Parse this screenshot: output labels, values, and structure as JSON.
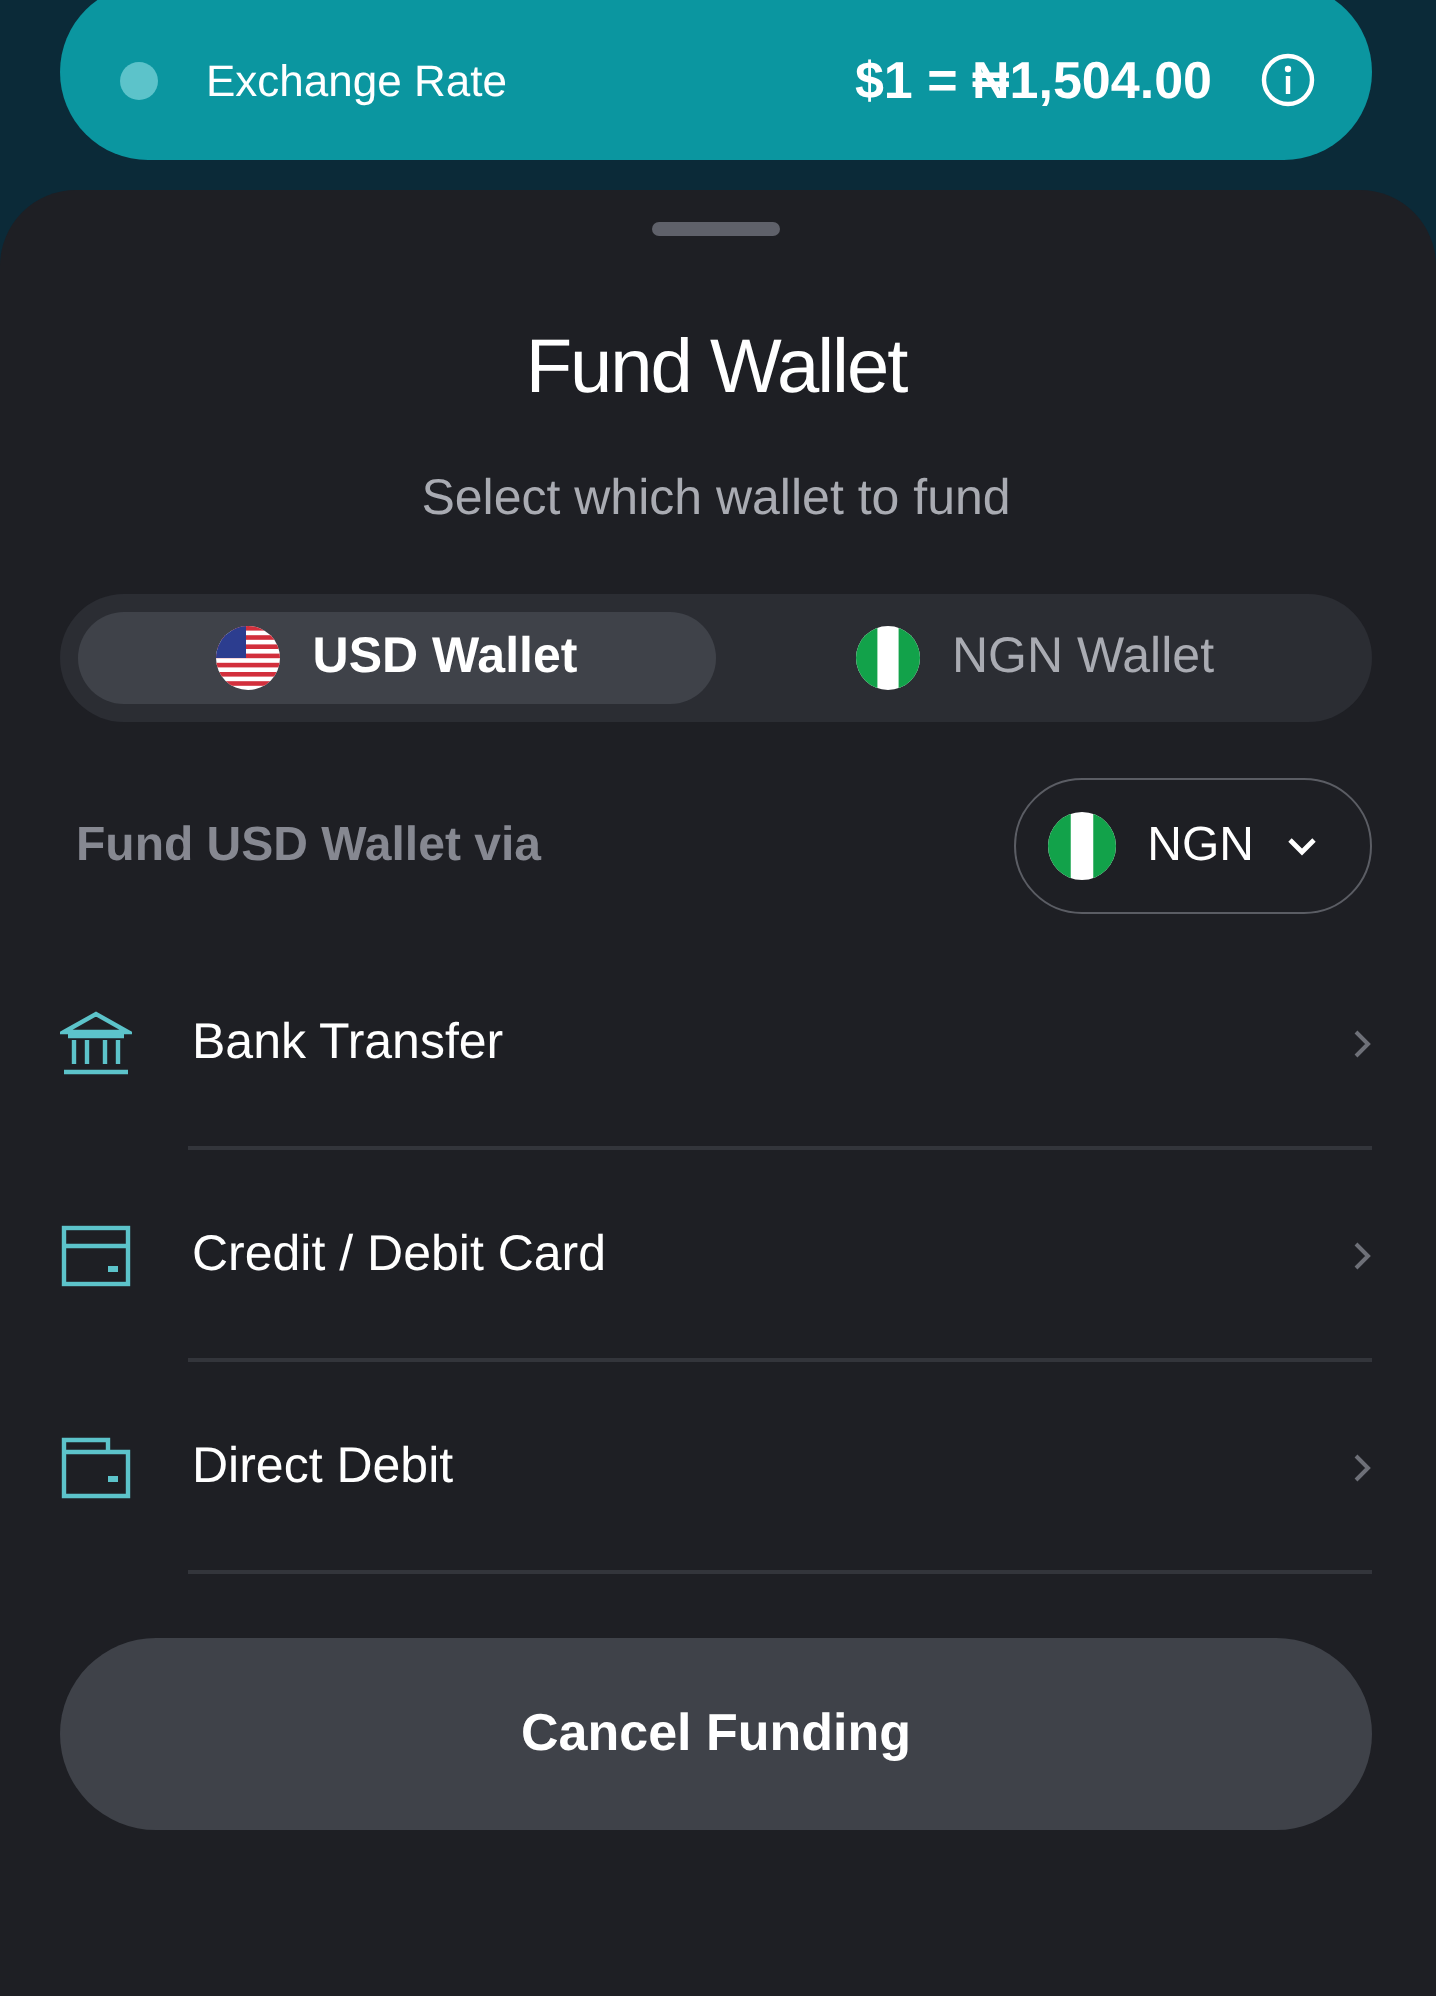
{
  "exchange_rate": {
    "label": "Exchange Rate",
    "value": "$1 = ₦1,504.00"
  },
  "sheet": {
    "title": "Fund Wallet",
    "subtitle": "Select which wallet to fund"
  },
  "wallet_tabs": [
    {
      "label": "USD Wallet",
      "kind": "us",
      "selected": true
    },
    {
      "label": "NGN Wallet",
      "kind": "ng",
      "selected": false
    }
  ],
  "fund_via": {
    "label": "Fund USD Wallet via",
    "currency": {
      "label": "NGN",
      "kind": "ng"
    }
  },
  "methods": [
    {
      "label": "Bank Transfer",
      "kind": "bank"
    },
    {
      "label": "Credit / Debit Card",
      "kind": "card"
    },
    {
      "label": "Direct Debit",
      "kind": "wallet"
    }
  ],
  "cancel_button": "Cancel Funding"
}
